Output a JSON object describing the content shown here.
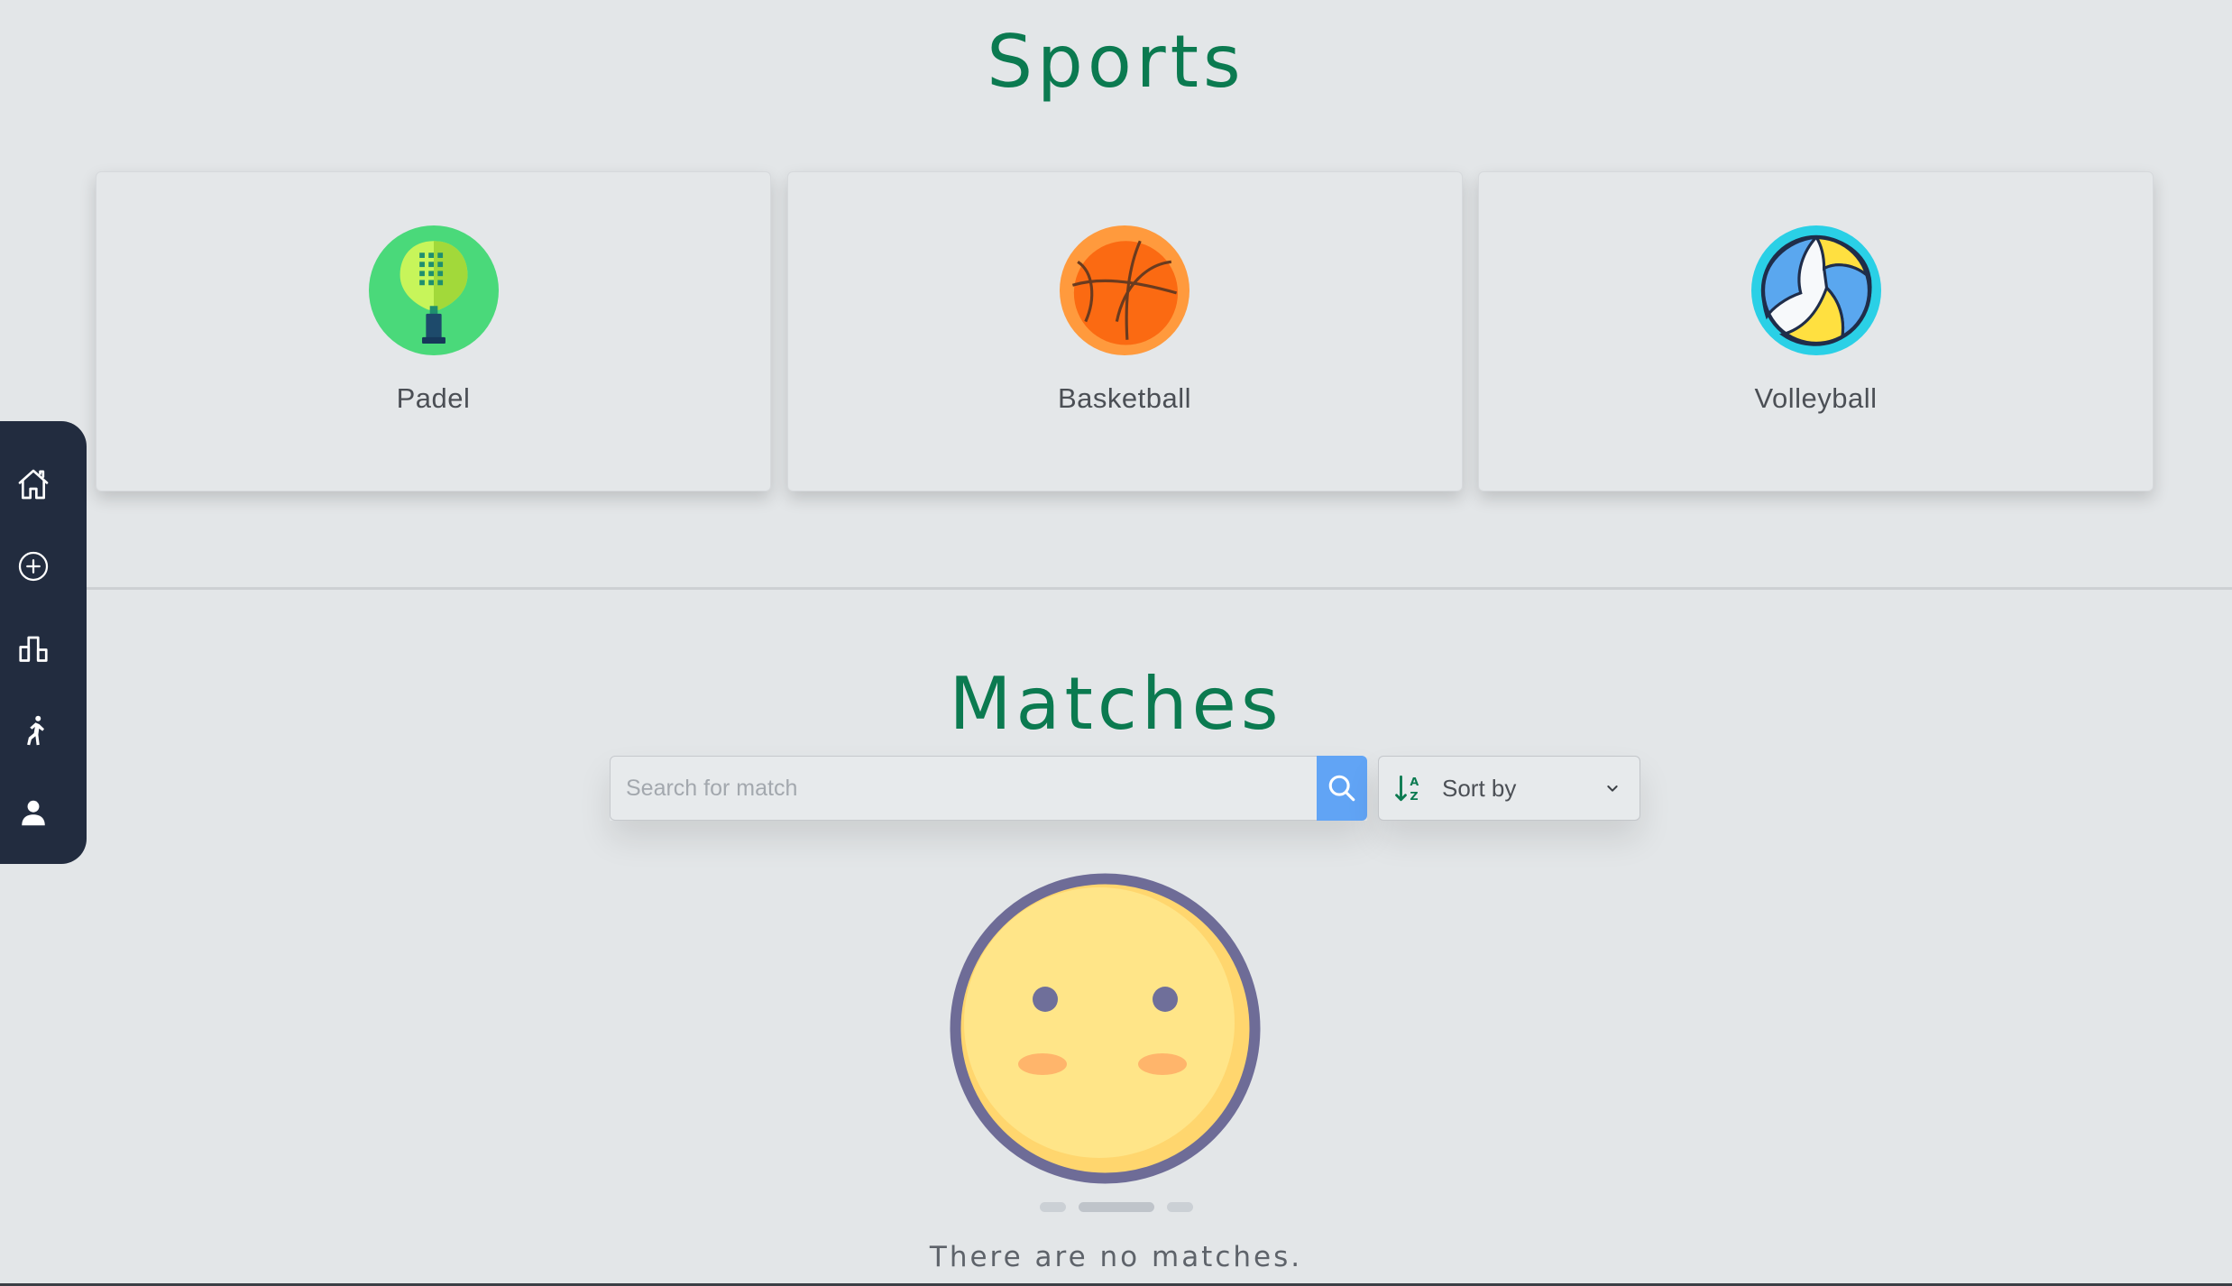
{
  "sports": {
    "title": "Sports",
    "cards": [
      {
        "label": "Padel",
        "icon": "padel-racket-icon"
      },
      {
        "label": "Basketball",
        "icon": "basketball-icon"
      },
      {
        "label": "Volleyball",
        "icon": "volleyball-icon"
      }
    ]
  },
  "matches": {
    "title": "Matches",
    "search_placeholder": "Search for match",
    "search_value": "",
    "sort_label": "Sort by",
    "empty_message": "There are no matches."
  },
  "sidebar": {
    "items": [
      {
        "icon": "home-icon"
      },
      {
        "icon": "add-circle-icon"
      },
      {
        "icon": "leaderboard-icon"
      },
      {
        "icon": "player-icon"
      },
      {
        "icon": "profile-icon"
      }
    ]
  },
  "colors": {
    "accent": "#0b7a50",
    "sidebar": "#222c3f",
    "search_button": "#61a4f5",
    "background": "#e3e6e8"
  }
}
